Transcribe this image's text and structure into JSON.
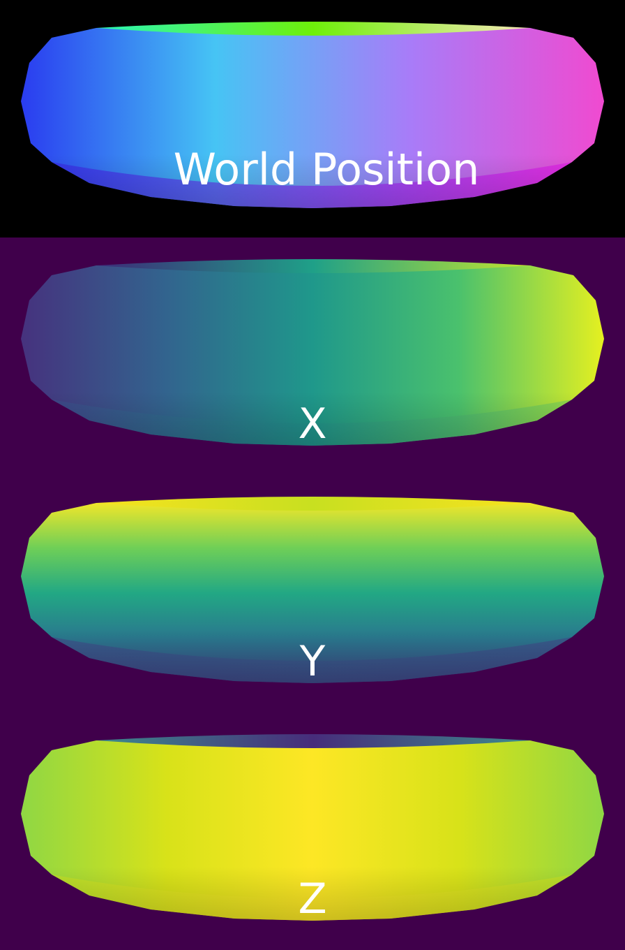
{
  "colors": {
    "world_background": "#000000",
    "channel_background": "#40004b",
    "label_text": "#ffffff"
  },
  "panels": [
    {
      "id": "world",
      "label": "World Position",
      "stops": {
        "body": [
          "#2a3cf0",
          "#46c4f4",
          "#a87cf8",
          "#f04ad0"
        ],
        "top": [
          "#2af7b8",
          "#6ef00a",
          "#f8e8b8"
        ],
        "bottom": [
          "#3620e0",
          "#8a14f8",
          "#e010e8"
        ]
      }
    },
    {
      "id": "x",
      "label": "X",
      "stops": {
        "body": [
          "#46327e",
          "#32648e",
          "#1f988b",
          "#4ac16d",
          "#e5f020"
        ],
        "top": [
          "#3d2a78",
          "#1fa088",
          "#c2e42e"
        ],
        "bottom": [
          "#3a4e8c",
          "#21918c",
          "#6ecd5a"
        ]
      }
    },
    {
      "id": "y",
      "label": "Y",
      "stops": {
        "body": [
          "#f0e62a",
          "#6fcf57",
          "#22a884",
          "#2a788e",
          "#414487"
        ],
        "top": [
          "#f7e21f",
          "#c8e020",
          "#f7e21f"
        ],
        "bottom": [
          "#414487",
          "#3b528b",
          "#414487"
        ]
      }
    },
    {
      "id": "z",
      "label": "Z",
      "stops": {
        "body": [
          "#8fd744",
          "#d8e219",
          "#fde725",
          "#d8e219",
          "#8fd744"
        ],
        "top": [
          "#3d8a8c",
          "#472d7b",
          "#3d8a8c"
        ],
        "bottom": [
          "#c8e020",
          "#fde725",
          "#c8e020"
        ]
      }
    }
  ]
}
